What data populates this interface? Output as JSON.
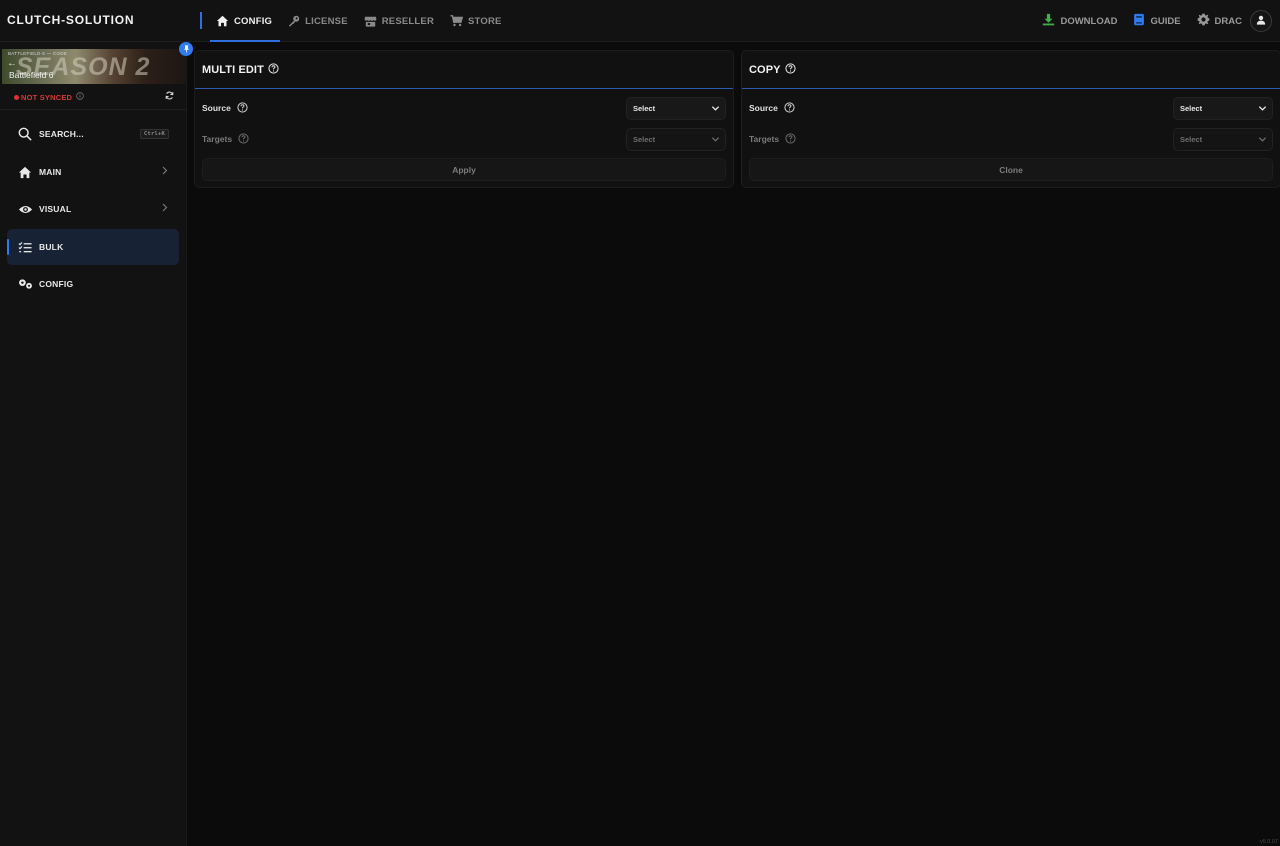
{
  "app": {
    "brand": "CLUTCH-SOLUTION",
    "version": "v5.0.07"
  },
  "topnav": {
    "items": [
      {
        "label": "CONFIG",
        "icon": "home-icon",
        "active": true
      },
      {
        "label": "LICENSE",
        "icon": "key-icon",
        "active": false
      },
      {
        "label": "RESELLER",
        "icon": "store-icon",
        "active": false
      },
      {
        "label": "STORE",
        "icon": "cart-icon",
        "active": false
      }
    ],
    "right": {
      "download": "DOWNLOAD",
      "guide": "GUIDE",
      "user": "DRAC"
    }
  },
  "sidebar": {
    "game": {
      "banner_small": "BATTLEFIELD 6  —  CODE",
      "banner_big": "SEASON 2",
      "name": "Battlefield 6"
    },
    "sync_status": "NOT SYNCED",
    "search": {
      "label": "SEARCH...",
      "shortcut": "Ctrl+K"
    },
    "items": [
      {
        "label": "MAIN",
        "icon": "home-icon",
        "has_submenu": true
      },
      {
        "label": "VISUAL",
        "icon": "eye-icon",
        "has_submenu": true
      },
      {
        "label": "BULK",
        "icon": "checklist-icon",
        "has_submenu": false,
        "active": true
      },
      {
        "label": "CONFIG",
        "icon": "gears-icon",
        "has_submenu": false
      }
    ]
  },
  "panels": {
    "multi_edit": {
      "title": "MULTI EDIT",
      "source_label": "Source",
      "source_value": "Select",
      "targets_label": "Targets",
      "targets_value": "Select",
      "action": "Apply"
    },
    "copy": {
      "title": "COPY",
      "source_label": "Source",
      "source_value": "Select",
      "targets_label": "Targets",
      "targets_value": "Select",
      "action": "Clone"
    }
  },
  "colors": {
    "accent": "#2f7bf0",
    "danger": "#e03030",
    "download_icon": "#3fae49",
    "guide_icon": "#2f7bf0"
  }
}
